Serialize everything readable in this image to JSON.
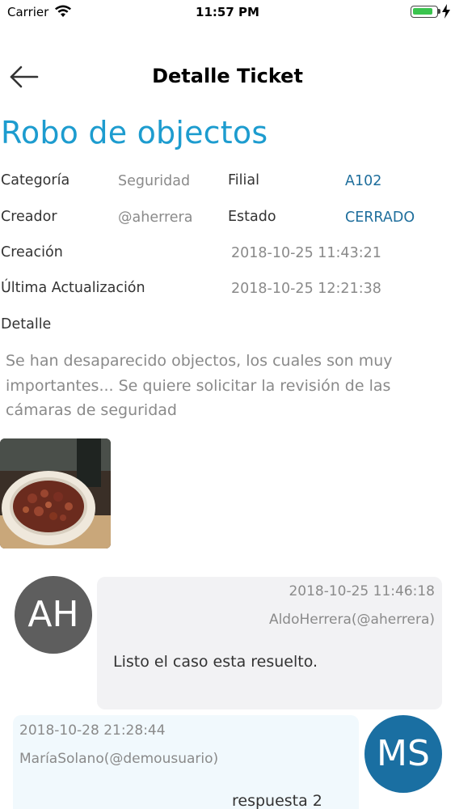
{
  "status_bar": {
    "carrier": "Carrier",
    "time": "11:57 PM",
    "battery_level": 0.9,
    "wifi_icon": "wifi-icon",
    "battery_icon": "battery-icon",
    "charging_icon": "bolt-icon"
  },
  "nav": {
    "title": "Detalle Ticket",
    "back_icon": "arrow-left-icon"
  },
  "ticket": {
    "title": "Robo de objectos",
    "categoria_label": "Categoría",
    "categoria_value": "Seguridad",
    "filial_label": "Filial",
    "filial_value": "A102",
    "creador_label": "Creador",
    "creador_value": "@aherrera",
    "estado_label": "Estado",
    "estado_value": "CERRADO",
    "creacion_label": "Creación",
    "creacion_value": "2018-10-25 11:43:21",
    "actualizacion_label": "Última Actualización",
    "actualizacion_value": "2018-10-25 12:21:38",
    "detalle_label": "Detalle",
    "detalle_text": "Se han desaparecido objectos, los cuales son muy importantes... Se quiere solicitar la revisión de las cámaras de seguridad"
  },
  "comments": [
    {
      "initials": "AH",
      "date": "2018-10-25 11:46:18",
      "user": "AldoHerrera(@aherrera)",
      "text": "Listo el caso esta resuelto.",
      "avatar_color": "#5e5e5e"
    },
    {
      "initials": "MS",
      "date": "2018-10-28 21:28:44",
      "user": "MaríaSolano(@demousuario)",
      "text": "respuesta 2",
      "avatar_color": "#1a6fa2"
    }
  ],
  "colors": {
    "accent_title": "#1d9ccf",
    "accent_value": "#1e6e9c",
    "bubble_gray": "#f2f2f4",
    "bubble_blue": "#f1f9fd"
  }
}
